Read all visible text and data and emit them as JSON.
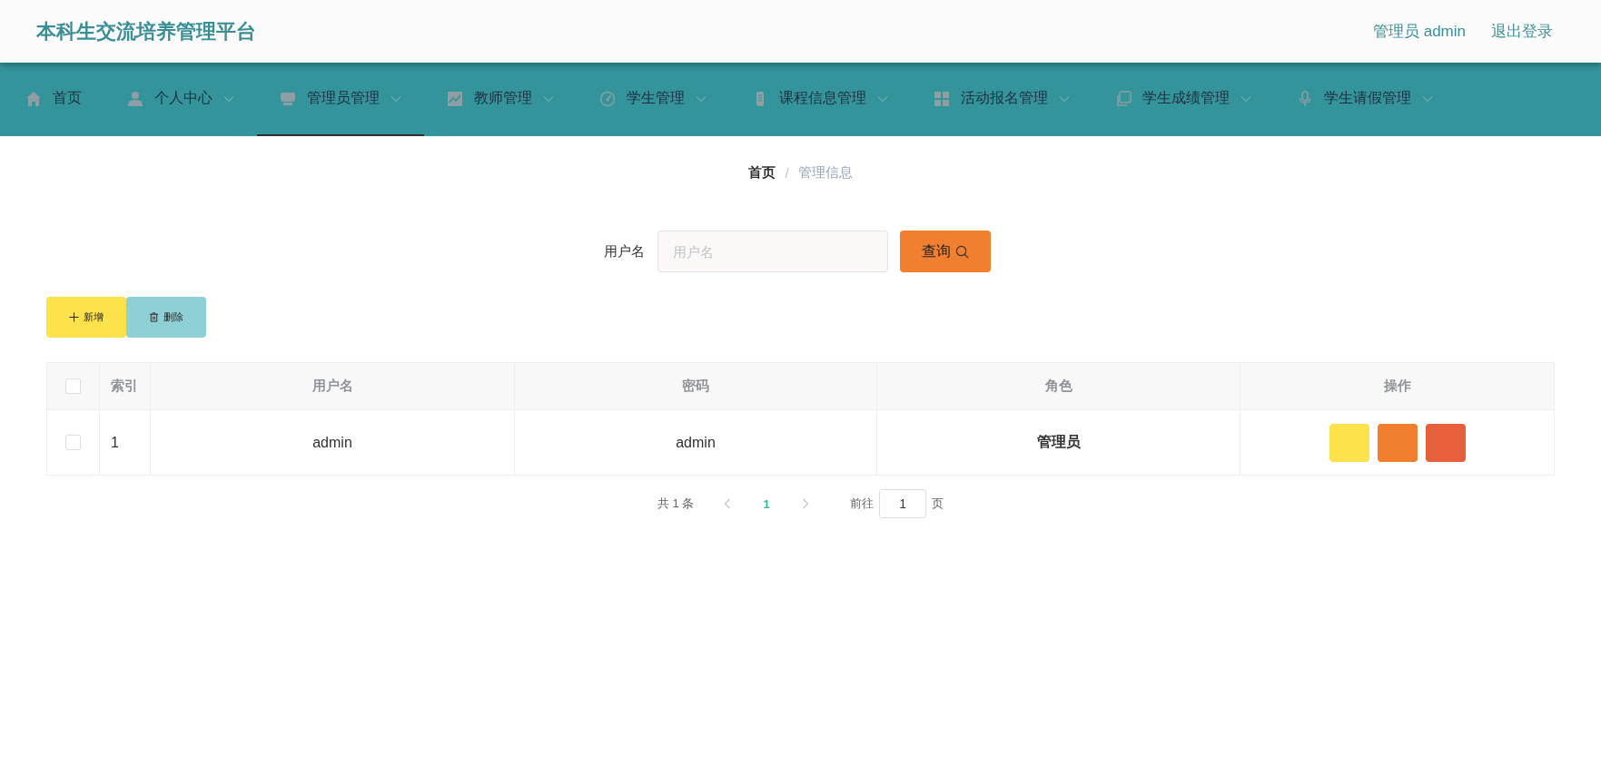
{
  "header": {
    "title": "本科生交流培养管理平台",
    "user": "管理员 admin",
    "logout": "退出登录"
  },
  "nav": [
    {
      "label": "首页",
      "dropdown": false,
      "selected": false
    },
    {
      "label": "个人中心",
      "dropdown": true,
      "selected": false
    },
    {
      "label": "管理员管理",
      "dropdown": true,
      "selected": true
    },
    {
      "label": "教师管理",
      "dropdown": true,
      "selected": false
    },
    {
      "label": "学生管理",
      "dropdown": true,
      "selected": false
    },
    {
      "label": "课程信息管理",
      "dropdown": true,
      "selected": false
    },
    {
      "label": "活动报名管理",
      "dropdown": true,
      "selected": false
    },
    {
      "label": "学生成绩管理",
      "dropdown": true,
      "selected": false
    },
    {
      "label": "学生请假管理",
      "dropdown": true,
      "selected": false
    }
  ],
  "breadcrumb": {
    "items": [
      {
        "label": "首页",
        "current": false
      },
      {
        "label": "管理信息",
        "current": true
      }
    ],
    "separator": "/"
  },
  "search": {
    "label": "用户名",
    "placeholder": "用户名",
    "button": "查询"
  },
  "actions": [
    {
      "label": "新增",
      "kind": "add"
    },
    {
      "label": "删除",
      "kind": "delete"
    }
  ],
  "table": {
    "all_checked": false,
    "columns": [
      "索引",
      "用户名",
      "密码",
      "角色",
      "操作"
    ],
    "rows": [
      {
        "checked": false,
        "cells": [
          "1",
          "admin",
          "admin",
          "管理员"
        ],
        "buttons": [
          {
            "color": "#fde24c"
          },
          {
            "color": "#f07f30"
          },
          {
            "color": "#e9603d"
          }
        ]
      }
    ]
  },
  "pagination": {
    "total": "共 1 条",
    "pages": [
      {
        "label": "1",
        "selected": true
      }
    ],
    "goto": "前往",
    "page": "1",
    "unit": "页"
  }
}
